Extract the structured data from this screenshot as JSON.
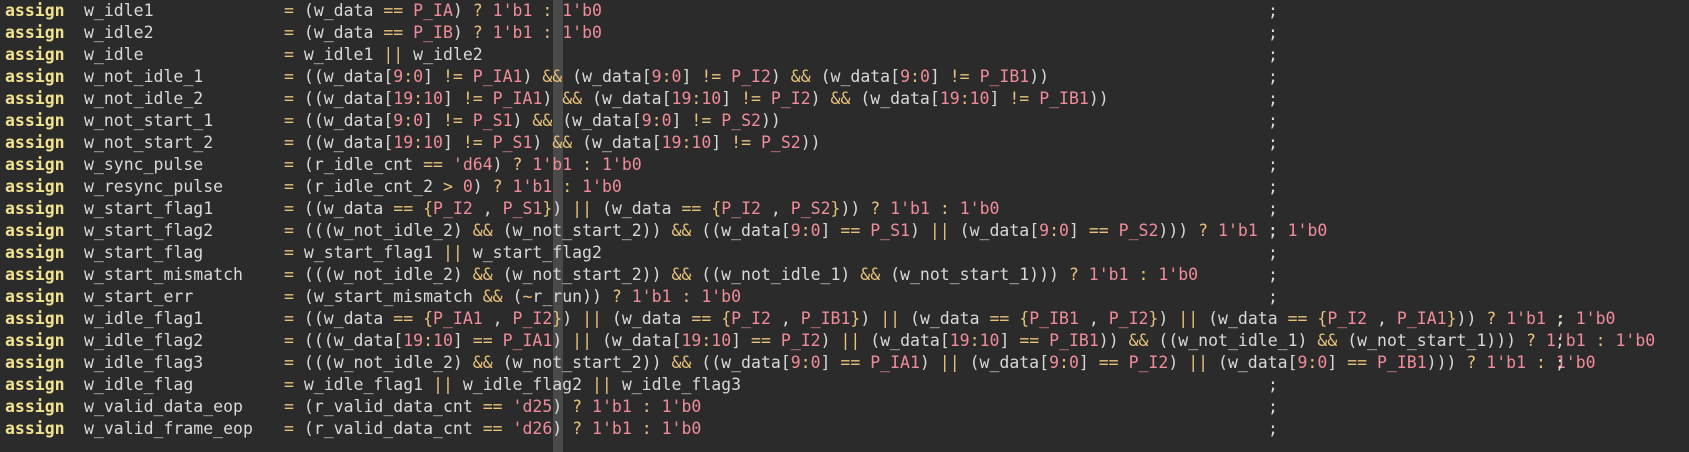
{
  "theme": {
    "background": "#2b2b2b",
    "keyword": "#f0e28e",
    "identifier": "#d8d8d8",
    "operator": "#e8c27a",
    "constant": "#f08c9a",
    "color_column": "#4a4a4a"
  },
  "lines": [
    {
      "keyword": "assign",
      "lhs": "w_idle1",
      "rhs": "= (w_data == P_IA) ? 1'b1 : 1'b0",
      "semi": ";"
    },
    {
      "keyword": "assign",
      "lhs": "w_idle2",
      "rhs": "= (w_data == P_IB) ? 1'b1 : 1'b0",
      "semi": ";"
    },
    {
      "keyword": "assign",
      "lhs": "w_idle",
      "rhs": "= w_idle1 || w_idle2",
      "semi": ";"
    },
    {
      "keyword": "assign",
      "lhs": "w_not_idle_1",
      "rhs": "= ((w_data[9:0] != P_IA1) && (w_data[9:0] != P_I2) && (w_data[9:0] != P_IB1))",
      "semi": ";"
    },
    {
      "keyword": "assign",
      "lhs": "w_not_idle_2",
      "rhs": "= ((w_data[19:10] != P_IA1) && (w_data[19:10] != P_I2) && (w_data[19:10] != P_IB1))",
      "semi": ";"
    },
    {
      "keyword": "assign",
      "lhs": "w_not_start_1",
      "rhs": "= ((w_data[9:0] != P_S1) && (w_data[9:0] != P_S2))",
      "semi": ";"
    },
    {
      "keyword": "assign",
      "lhs": "w_not_start_2",
      "rhs": "= ((w_data[19:10] != P_S1) && (w_data[19:10] != P_S2))",
      "semi": ";"
    },
    {
      "keyword": "assign",
      "lhs": "w_sync_pulse",
      "rhs": "= (r_idle_cnt == 'd64) ? 1'b1 : 1'b0",
      "semi": ";"
    },
    {
      "keyword": "assign",
      "lhs": "w_resync_pulse",
      "rhs": "= (r_idle_cnt_2 > 0) ? 1'b1 : 1'b0",
      "semi": ";"
    },
    {
      "keyword": "assign",
      "lhs": "w_start_flag1",
      "rhs": "= ((w_data == {P_I2 , P_S1}) || (w_data == {P_I2 , P_S2})) ? 1'b1 : 1'b0",
      "semi": ";"
    },
    {
      "keyword": "assign",
      "lhs": "w_start_flag2",
      "rhs": "= (((w_not_idle_2) && (w_not_start_2)) && ((w_data[9:0] == P_S1) || (w_data[9:0] == P_S2))) ? 1'b1 : 1'b0",
      "semi": ";"
    },
    {
      "keyword": "assign",
      "lhs": "w_start_flag",
      "rhs": "= w_start_flag1 || w_start_flag2",
      "semi": ";"
    },
    {
      "keyword": "assign",
      "lhs": "w_start_mismatch",
      "rhs": "= (((w_not_idle_2) && (w_not_start_2)) && ((w_not_idle_1) && (w_not_start_1))) ? 1'b1 : 1'b0",
      "semi": ";"
    },
    {
      "keyword": "assign",
      "lhs": "w_start_err",
      "rhs": "= (w_start_mismatch && (~r_run)) ? 1'b1 : 1'b0",
      "semi": ";"
    },
    {
      "keyword": "assign",
      "lhs": "w_idle_flag1",
      "rhs": "= ((w_data == {P_IA1 , P_I2}) || (w_data == {P_I2 , P_IB1}) || (w_data == {P_IB1 , P_I2}) || (w_data == {P_I2 , P_IA1})) ? 1'b1 : 1'b0",
      "semi": ";"
    },
    {
      "keyword": "assign",
      "lhs": "w_idle_flag2",
      "rhs": "= (((w_data[19:10] == P_IA1) || (w_data[19:10] == P_I2) || (w_data[19:10] == P_IB1)) && ((w_not_idle_1) && (w_not_start_1))) ? 1'b1 : 1'b0",
      "semi": ";"
    },
    {
      "keyword": "assign",
      "lhs": "w_idle_flag3",
      "rhs": "= (((w_not_idle_2) && (w_not_start_2)) && ((w_data[9:0] == P_IA1) || (w_data[9:0] == P_I2) || (w_data[9:0] == P_IB1))) ? 1'b1 : 1'b0",
      "semi": ";"
    },
    {
      "keyword": "assign",
      "lhs": "w_idle_flag",
      "rhs": "= w_idle_flag1 || w_idle_flag2 || w_idle_flag3",
      "semi": ";"
    },
    {
      "keyword": "assign",
      "lhs": "w_valid_data_eop",
      "rhs": "= (r_valid_data_cnt == 'd25) ? 1'b1 : 1'b0",
      "semi": ";"
    },
    {
      "keyword": "assign",
      "lhs": "w_valid_frame_eop",
      "rhs": "= (r_valid_data_cnt == 'd26) ? 1'b1 : 1'b0",
      "semi": ";"
    }
  ]
}
